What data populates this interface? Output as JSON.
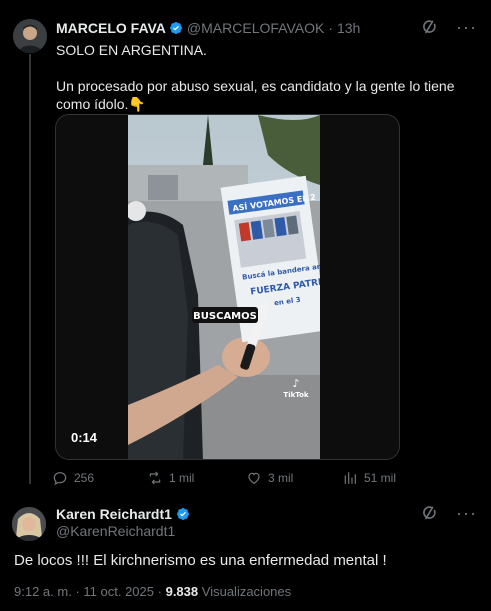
{
  "quoted_tweet": {
    "author_name": "MARCELO FAVA",
    "handle": "@MARCELOFAVAOK",
    "separator": "·",
    "time": "13h",
    "text_line1": "SOLO EN ARGENTINA.",
    "text_line2": "Un procesado por abuso sexual, es candidato y la gente lo tiene como ídolo.👇",
    "video": {
      "duration": "0:14",
      "caption": "BUSCAMOS",
      "sign_top": "ASÍ VOTAMOS EL 2",
      "sign_line1": "Buscá la bandera arg",
      "sign_line2": "FUERZA PATRI",
      "sign_line3": "en el 3",
      "watermark": "TikTok"
    },
    "actions": {
      "replies": "256",
      "reposts": "1 mil",
      "likes": "3 mil",
      "views": "51 mil"
    }
  },
  "main_tweet": {
    "author_name": "Karen Reichardt1",
    "handle": "@KarenReichardt1",
    "text": "De locos !!! El kirchnerismo es una enfermedad mental !",
    "time": "9:12 a. m.",
    "separator": "·",
    "date": "11 oct. 2025",
    "separator2": "·",
    "views_count": "9.838",
    "views_label": "Visualizaciones"
  },
  "colors": {
    "background": "#000000",
    "text": "#e7e9ea",
    "muted": "#71767b",
    "verified": "#1d9bf0",
    "border": "#2f3336"
  },
  "icons": [
    "verified-badge-icon",
    "grok-icon",
    "more-icon",
    "reply-icon",
    "repost-icon",
    "like-icon",
    "views-icon"
  ]
}
